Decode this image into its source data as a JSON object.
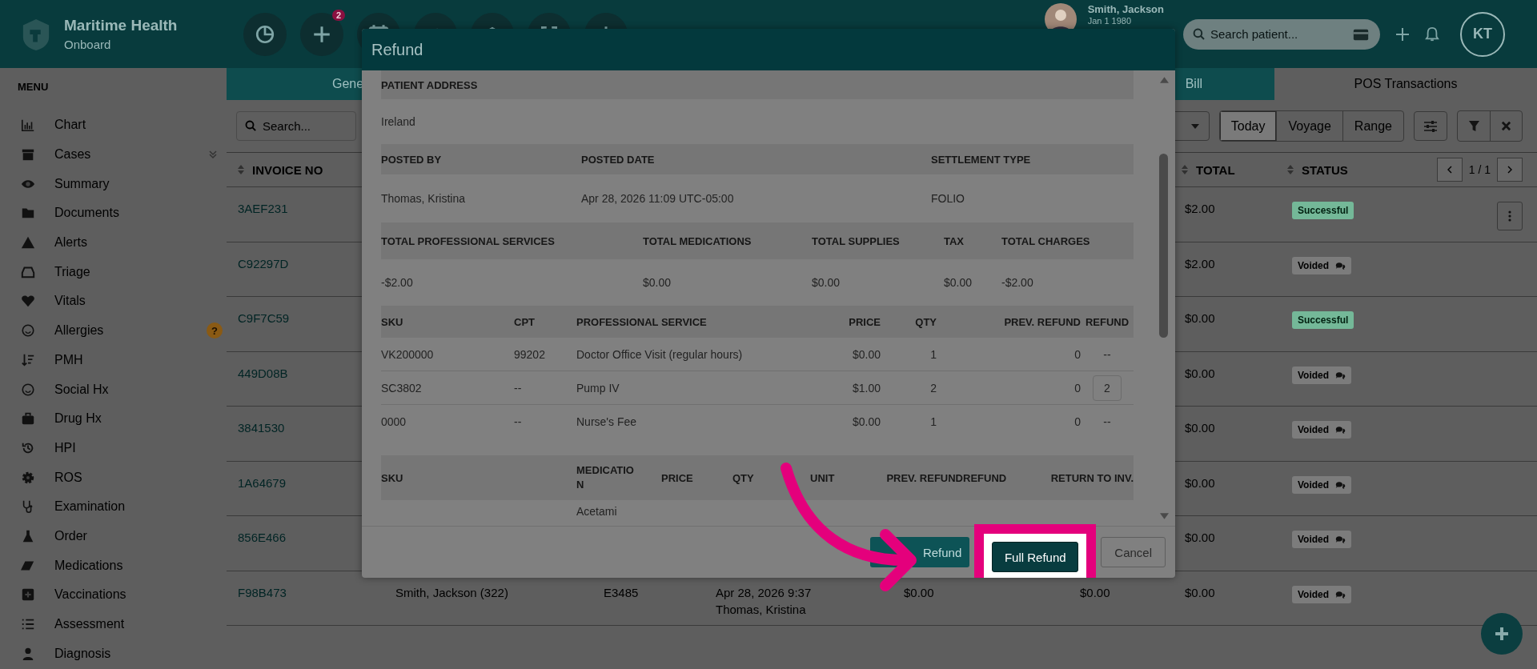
{
  "topbar": {
    "brand": "Maritime Health",
    "subtitle": "Onboard",
    "notification_count": "2",
    "patient": {
      "name": "Smith, Jackson",
      "dob": "Jan 1 1980"
    },
    "search": {
      "placeholder": "Search patient..."
    },
    "user_initials": "KT"
  },
  "sidebar": {
    "heading": "MENU",
    "items": [
      {
        "label": "Chart",
        "has_submenu": false
      },
      {
        "label": "Cases",
        "has_submenu": true
      },
      {
        "label": "Summary",
        "has_submenu": false
      },
      {
        "label": "Documents",
        "has_submenu": false
      },
      {
        "label": "Alerts",
        "has_submenu": false
      },
      {
        "label": "Triage",
        "has_submenu": false
      },
      {
        "label": "Vitals",
        "has_submenu": false
      },
      {
        "label": "Allergies",
        "has_submenu": false,
        "badge": "?"
      },
      {
        "label": "PMH",
        "has_submenu": false
      },
      {
        "label": "Social Hx",
        "has_submenu": false
      },
      {
        "label": "Drug Hx",
        "has_submenu": false
      },
      {
        "label": "HPI",
        "has_submenu": false
      },
      {
        "label": "ROS",
        "has_submenu": false
      },
      {
        "label": "Examination",
        "has_submenu": false
      },
      {
        "label": "Order",
        "has_submenu": false
      },
      {
        "label": "Medications",
        "has_submenu": false
      },
      {
        "label": "Vaccinations",
        "has_submenu": false
      },
      {
        "label": "Assessment",
        "has_submenu": false
      },
      {
        "label": "Diagnosis",
        "has_submenu": false
      }
    ]
  },
  "tabs": [
    {
      "label": "Gene",
      "selected": false
    },
    {
      "label": "Bill",
      "selected": false
    },
    {
      "label": "POS Transactions",
      "selected": true
    }
  ],
  "filters": {
    "search": {
      "placeholder": "Search..."
    },
    "ranges": [
      {
        "label": "Today",
        "selected": true
      },
      {
        "label": "Voyage",
        "selected": false
      },
      {
        "label": "Range",
        "selected": false
      }
    ]
  },
  "table": {
    "columns": [
      {
        "label": "INVOICE NO"
      },
      {
        "label": "TOTAL"
      },
      {
        "label": "STATUS"
      }
    ],
    "pager": "1 / 1",
    "rows": [
      {
        "invoice": "3AEF231",
        "total": "$2.00",
        "status": {
          "label": "Successful",
          "kind": "successful"
        },
        "has_menu": true
      },
      {
        "invoice": "C92297D",
        "total": "$2.00",
        "status": {
          "label": "Voided",
          "kind": "voided"
        },
        "has_menu": false
      },
      {
        "invoice": "C9F7C59",
        "total": "$0.00",
        "status": {
          "label": "Successful",
          "kind": "successful"
        },
        "has_menu": false
      },
      {
        "invoice": "449D08B",
        "total": "$0.00",
        "status": {
          "label": "Voided",
          "kind": "voided"
        },
        "has_menu": false
      },
      {
        "invoice": "3841530",
        "total": "$0.00",
        "status": {
          "label": "Voided",
          "kind": "voided"
        },
        "has_menu": false
      },
      {
        "invoice": "1A64679",
        "total": "$0.00",
        "status": {
          "label": "Voided",
          "kind": "voided"
        },
        "has_menu": false
      },
      {
        "invoice": "856E466",
        "total": "$0.00",
        "status": {
          "label": "Voided",
          "kind": "voided"
        },
        "has_menu": false
      },
      {
        "invoice": "F98B473",
        "patient": "Smith, Jackson (322)",
        "column_3": "E3485",
        "posted_date": "Apr 28, 2026 9:37",
        "posted_by": "Thomas, Kristina",
        "column_5": "$0.00",
        "column_6": "$0.00",
        "total": "$0.00",
        "status": {
          "label": "Voided",
          "kind": "voided"
        },
        "has_menu": false
      }
    ]
  },
  "modal": {
    "title": "Refund",
    "sections": [
      {
        "kind": "address",
        "columns": [
          "PATIENT ADDRESS"
        ],
        "rows": [
          {
            "cells": [
              "Ireland"
            ]
          }
        ]
      },
      {
        "kind": "posting",
        "columns": [
          "POSTED BY",
          "POSTED DATE",
          "SETTLEMENT TYPE"
        ],
        "rows": [
          {
            "cells": [
              "Thomas, Kristina",
              "Apr 28, 2026 11:09 UTC-05:00",
              "FOLIO"
            ]
          }
        ]
      },
      {
        "kind": "totals",
        "columns": [
          "TOTAL PROFESSIONAL SERVICES",
          "TOTAL MEDICATIONS",
          "TOTAL SUPPLIES",
          "TAX",
          "TOTAL CHARGES"
        ],
        "rows": [
          {
            "cells": [
              "-$2.00",
              "$0.00",
              "$0.00",
              "$0.00",
              "-$2.00"
            ]
          }
        ]
      },
      {
        "kind": "services",
        "columns": [
          "SKU",
          "CPT",
          "PROFESSIONAL SERVICE",
          "PRICE",
          "QTY",
          "PREV. REFUND",
          "REFUND"
        ],
        "rows": [
          {
            "cells": [
              "VK200000",
              "99202",
              "Doctor Office Visit (regular hours)",
              "$0.00",
              "1",
              "0",
              "--"
            ],
            "refund_editable": false
          },
          {
            "cells": [
              "SC3802",
              "--",
              "Pump IV",
              "$1.00",
              "2",
              "0",
              "2"
            ],
            "refund_editable": true
          },
          {
            "cells": [
              "0000",
              "--",
              "Nurse's Fee",
              "$0.00",
              "1",
              "0",
              "--"
            ],
            "refund_editable": false
          }
        ]
      },
      {
        "kind": "medications",
        "columns": [
          "SKU",
          "MEDICATION",
          "PRICE",
          "QTY",
          "UNIT",
          "PREV. REFUND",
          "REFUND",
          "RETURN TO INV."
        ],
        "rows": [
          {
            "cells": [
              "",
              "Acetami",
              "",
              "",
              "",
              "",
              "",
              ""
            ]
          }
        ]
      }
    ],
    "buttons": [
      {
        "label": "Refund",
        "kind": "secondary",
        "highlighted": false
      },
      {
        "label": "Full Refund",
        "kind": "primary",
        "highlighted": true
      },
      {
        "label": "Cancel",
        "kind": "outline",
        "highlighted": false
      }
    ]
  }
}
